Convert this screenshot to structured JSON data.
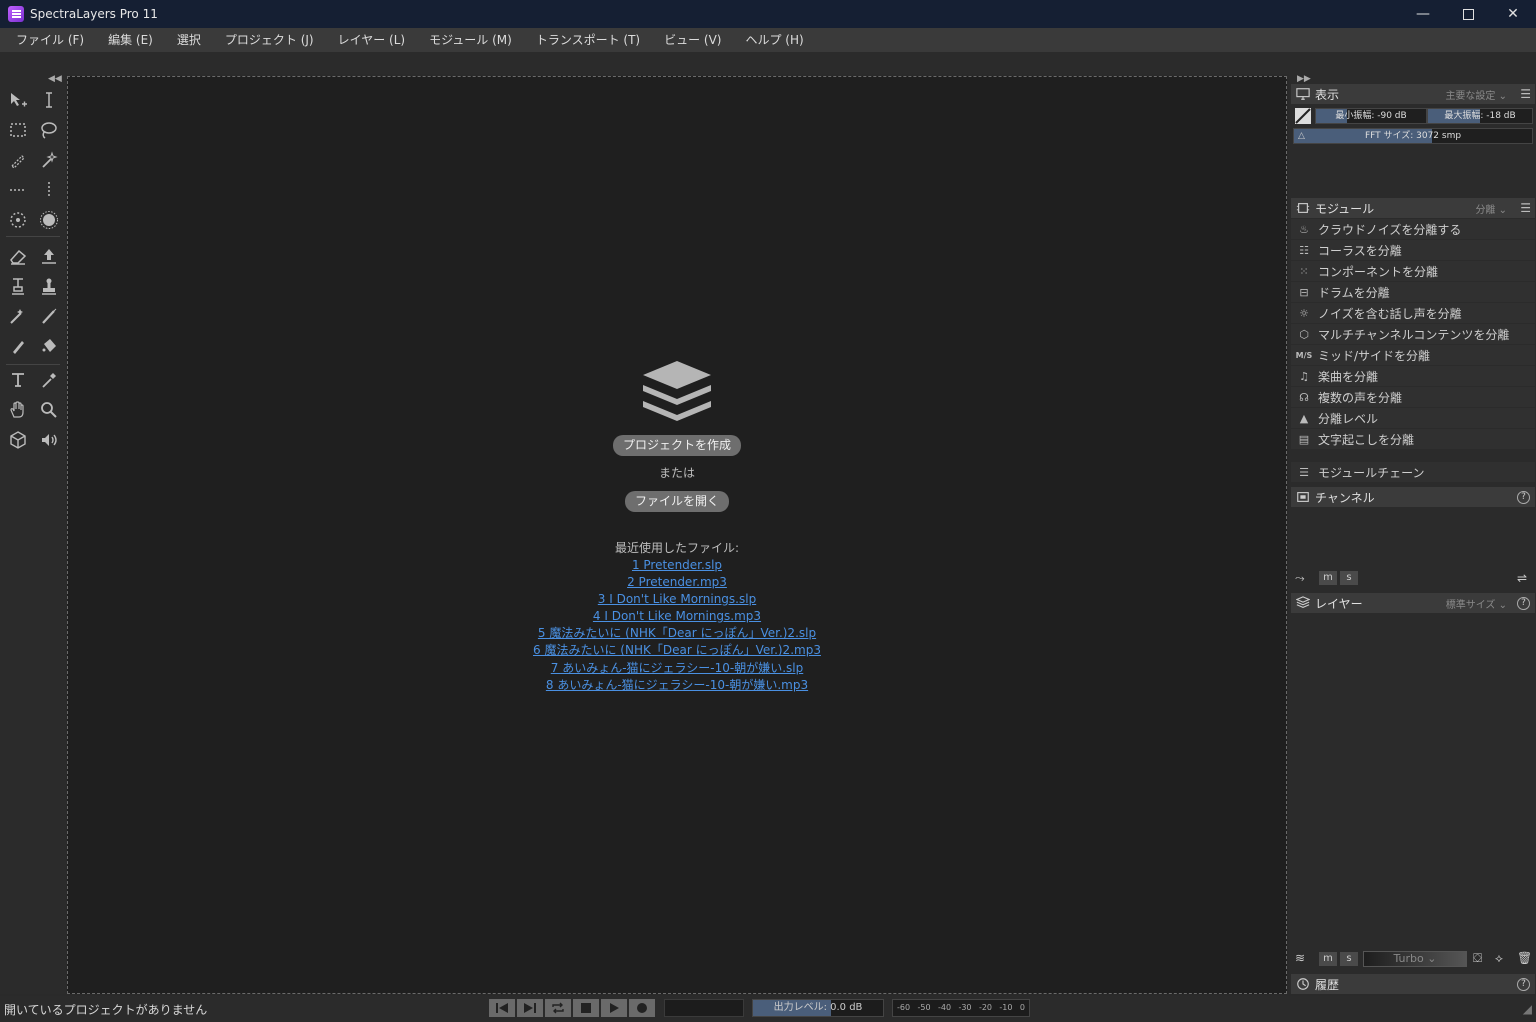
{
  "window": {
    "title": "SpectraLayers Pro 11"
  },
  "menu": [
    "ファイル (F)",
    "編集 (E)",
    "選択",
    "プロジェクト (J)",
    "レイヤー (L)",
    "モジュール (M)",
    "トランスポート (T)",
    "ビュー (V)",
    "ヘルプ (H)"
  ],
  "welcome": {
    "create_button": "プロジェクトを作成",
    "or_text": "または",
    "open_button": "ファイルを開く",
    "recent_label": "最近使用したファイル:",
    "recent_files": [
      "1 Pretender.slp",
      "2 Pretender.mp3",
      "3 I Don't Like Mornings.slp",
      "4 I Don't Like Mornings.mp3",
      "5 魔法みたいに (NHK「Dear にっぽん」Ver.)2.slp",
      "6 魔法みたいに (NHK「Dear にっぽん」Ver.)2.mp3",
      "7 あいみょん-猫にジェラシー-10-朝が嫌い.slp",
      "8 あいみょん-猫にジェラシー-10-朝が嫌い.mp3"
    ]
  },
  "display_panel": {
    "title": "表示",
    "option": "主要な設定",
    "min_level": "最小振幅: -90 dB",
    "max_level": "最大振幅: -18 dB",
    "fft_size": "FFT サイズ: 3072 smp"
  },
  "module_panel": {
    "title": "モジュール",
    "option": "分離",
    "items": [
      {
        "label": "クラウドノイズを分離する",
        "icon": "crowd-icon"
      },
      {
        "label": "コーラスを分離",
        "icon": "chorus-icon"
      },
      {
        "label": "コンポーネントを分離",
        "icon": "component-icon"
      },
      {
        "label": "ドラムを分離",
        "icon": "drum-icon"
      },
      {
        "label": "ノイズを含む話し声を分離",
        "icon": "noisy-speech-icon"
      },
      {
        "label": "マルチチャンネルコンテンツを分離",
        "icon": "multichannel-icon"
      },
      {
        "label": "ミッド/サイドを分離",
        "icon": "mid-side-icon",
        "glyph": "M/S"
      },
      {
        "label": "楽曲を分離",
        "icon": "music-note-icon"
      },
      {
        "label": "複数の声を分離",
        "icon": "voices-icon"
      },
      {
        "label": "分離レベル",
        "icon": "level-icon"
      },
      {
        "label": "文字起こしを分離",
        "icon": "transcript-icon"
      }
    ],
    "chain": "モジュールチェーン"
  },
  "channel_panel": {
    "title": "チャンネル",
    "m": "m",
    "s": "s"
  },
  "layer_panel": {
    "title": "レイヤー",
    "option": "標準サイズ",
    "m": "m",
    "s": "s",
    "mode": "Turbo"
  },
  "history_panel": {
    "title": "履歴"
  },
  "status": {
    "text": "開いているプロジェクトがありません",
    "output_level": "出力レベル: 0.0 dB",
    "output_level_fill": 0.6,
    "meter_ticks": [
      "-60",
      "-50",
      "-40",
      "-30",
      "-20",
      "-10",
      "0"
    ]
  },
  "sliders": {
    "min_fill": 0.28,
    "max_fill": 0.5,
    "fft_fill": 0.58
  }
}
